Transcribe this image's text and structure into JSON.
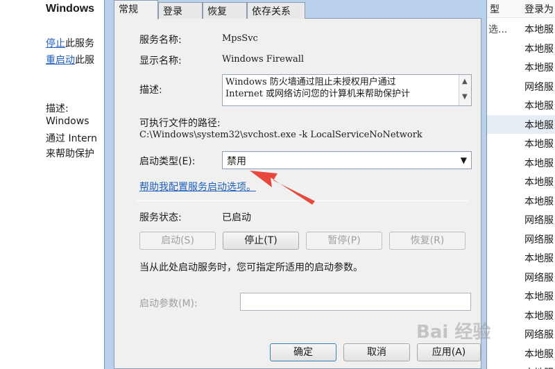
{
  "background_left": {
    "title": "Windows",
    "stop_link": "停止",
    "stop_suffix": "此服务",
    "restart_link": "重启动",
    "restart_suffix": "此服",
    "desc_label": "描述:",
    "desc_line1": "Windows",
    "desc_line2": "通过 Intern",
    "desc_line3": "来帮助保护"
  },
  "background_right": {
    "col_state": "型",
    "col_logon": "登录为",
    "rows": [
      {
        "sub": "选...",
        "logon": "本地服"
      },
      {
        "sub": "",
        "logon": "本地服"
      },
      {
        "sub": "",
        "logon": "本地服"
      },
      {
        "sub": "",
        "logon": "网络服"
      },
      {
        "sub": "",
        "logon": "本地服"
      },
      {
        "sub": "",
        "logon": "本地服"
      },
      {
        "sub": "",
        "logon": "本地服"
      },
      {
        "sub": "",
        "logon": "本地服"
      },
      {
        "sub": "",
        "logon": "本地服"
      },
      {
        "sub": "",
        "logon": "本地服"
      },
      {
        "sub": "",
        "logon": "网络服"
      },
      {
        "sub": "",
        "logon": "网络服"
      },
      {
        "sub": "",
        "logon": "本地服"
      },
      {
        "sub": "",
        "logon": "网络服"
      },
      {
        "sub": "",
        "logon": "本地服"
      },
      {
        "sub": "",
        "logon": "本地服"
      },
      {
        "sub": "",
        "logon": "网络服"
      },
      {
        "sub": "",
        "logon": "本地服"
      },
      {
        "sub": "",
        "logon": "本地服"
      }
    ]
  },
  "tabs": [
    "常规",
    "登录",
    "恢复",
    "依存关系"
  ],
  "general": {
    "service_name_label": "服务名称:",
    "service_name": "MpsSvc",
    "display_name_label": "显示名称:",
    "display_name": "Windows Firewall",
    "description_label": "描述:",
    "description": "Windows 防火墙通过阻止未授权用户通过\nInternet 或网络访问您的计算机来帮助保护计",
    "path_label": "可执行文件的路径:",
    "path": "C:\\Windows\\system32\\svchost.exe -k LocalServiceNoNetwork",
    "startup_type_label": "启动类型(E):",
    "startup_type_value": "禁用",
    "help_link": "帮助我配置服务启动选项。",
    "status_label": "服务状态:",
    "status_value": "已启动",
    "start_button": "启动(S)",
    "stop_button": "停止(T)",
    "pause_button": "暂停(P)",
    "resume_button": "恢复(R)",
    "start_params_hint": "当从此处启动服务时，您可指定所适用的启动参数。",
    "start_params_label": "启动参数(M):",
    "start_params_value": ""
  },
  "footer": {
    "ok": "确定",
    "cancel": "取消",
    "apply": "应用(A)"
  },
  "watermark": "Bai 经验",
  "colors": {
    "accent_arrow": "#e8483c",
    "link": "#1f5fbf",
    "frame": "#b9d1ea"
  }
}
